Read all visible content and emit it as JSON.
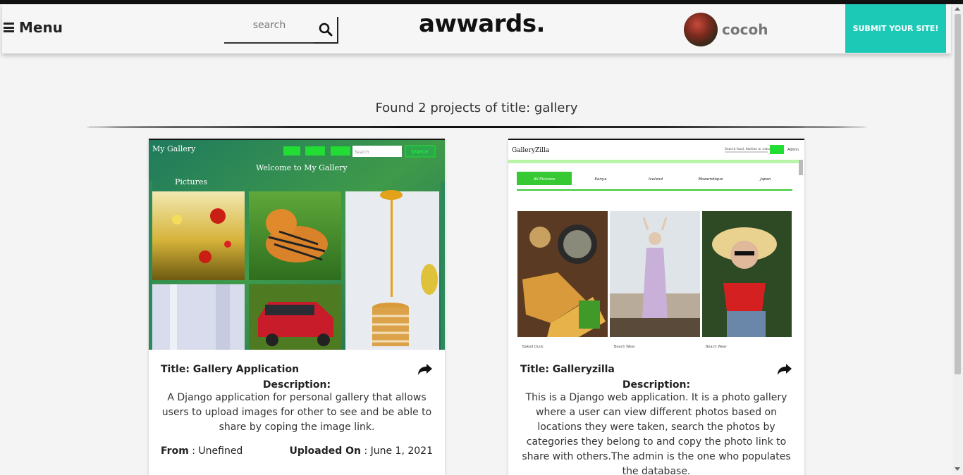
{
  "header": {
    "menu_label": "Menu",
    "search": {
      "placeholder": "search",
      "value": ""
    },
    "brand": "awwards.",
    "username": "cocoh",
    "submit_label": "SUBMIT YOUR SITE!"
  },
  "results": {
    "heading": "Found 2 projects of title: gallery"
  },
  "projects": [
    {
      "title": "Title: Gallery Application",
      "description_label": "Description:",
      "description": "A Django application for personal gallery that allows users to upload images for other to see and be able to share by coping the image link.",
      "from_label": "From",
      "from_value": " : Unefined",
      "uploaded_label": "Uploaded On",
      "uploaded_value": " : June 1, 2021",
      "screenshot": {
        "site_title": "My Gallery",
        "welcome": "Welcome to My Gallery",
        "section": "Pictures",
        "search_placeholder": "Search",
        "search_button": "SEARCH"
      }
    },
    {
      "title": "Title: Galleryzilla",
      "description_label": "Description:",
      "description": "This is a Django web application. It is a photo gallery where a user can view different photos based on locations they were taken, search the photos by categories they belong to and copy the photo link to share with others.The admin is the one who populates the database.",
      "screenshot": {
        "site_title": "GalleryZilla",
        "search_placeholder": "Search food, fashion or nature",
        "admin": "Admin",
        "tabs": [
          "All Pictures",
          "Kenya",
          "Iceland",
          "Mozambique",
          "Japan"
        ],
        "captions": [
          "Baked Duck",
          "Beach Wear",
          "Beach Wear"
        ]
      }
    }
  ],
  "colors": {
    "accent": "#1cc9b7",
    "gallery_green": "#39d32f"
  }
}
